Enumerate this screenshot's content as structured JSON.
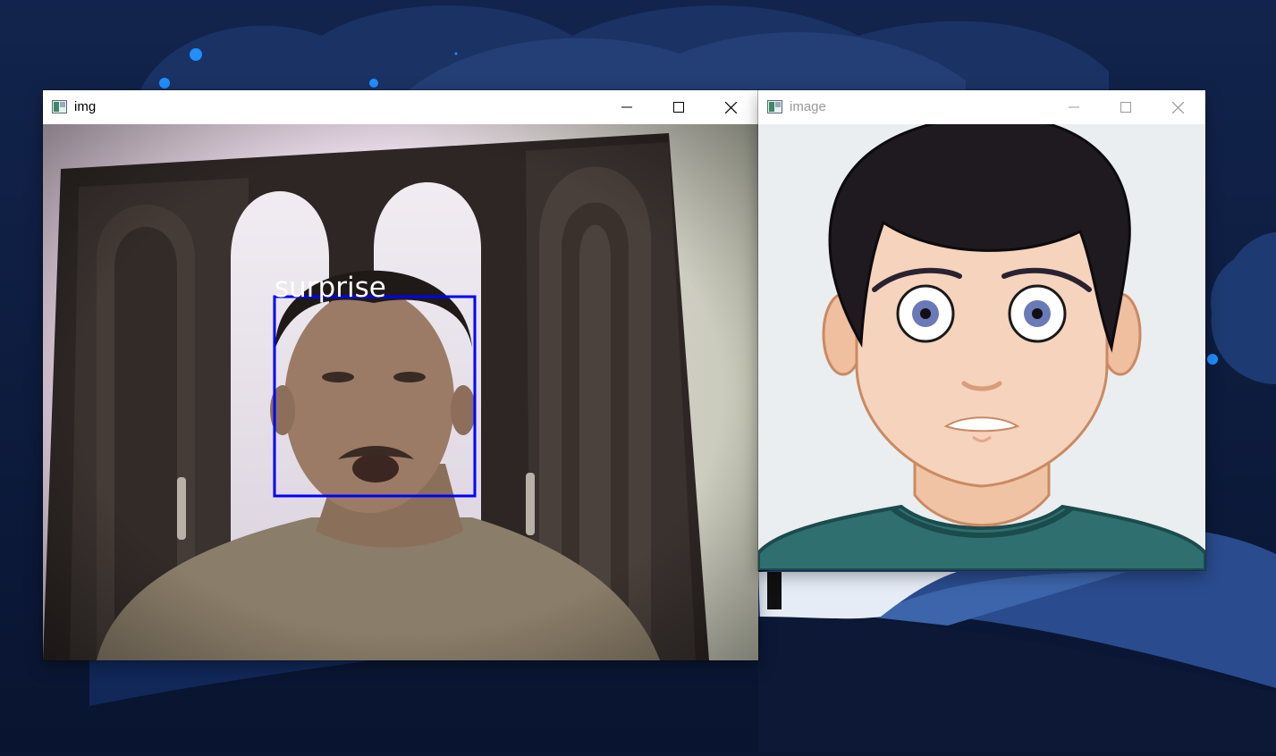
{
  "windows": {
    "img": {
      "title": "img",
      "detection": {
        "label": "surprise",
        "box_color": "#0000ff",
        "label_color": "#ffffff"
      }
    },
    "image": {
      "title": "image"
    }
  },
  "icons": {
    "window_icon": "app-image-icon",
    "minimize": "minimize-icon",
    "maximize": "maximize-icon",
    "close": "close-icon"
  },
  "colors": {
    "desktop_bg": "#0b1633",
    "accent_dot": "#1e90ff",
    "shirt": "#2f6f70"
  }
}
